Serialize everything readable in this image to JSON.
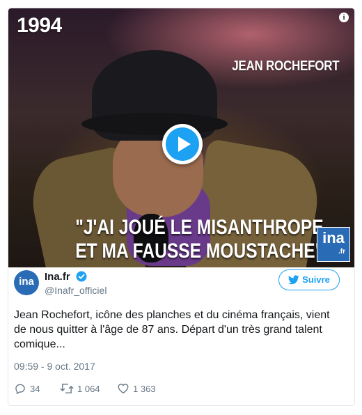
{
  "media": {
    "year": "1994",
    "name_tag": "JEAN ROCHEFORT",
    "quote_line1": "\"J'AI JOUÉ LE MISANTHROPE",
    "quote_line2": "ET MA FAUSSE MOUSTACHE\"",
    "logo_text": "ina",
    "logo_suffix": ".fr",
    "info_icon": "info-icon",
    "play_icon": "play-icon"
  },
  "author": {
    "display_name": "Ina.fr",
    "handle": "@Inafr_officiel",
    "avatar_text": "ina",
    "verified_icon": "verified-badge-icon"
  },
  "follow_button": {
    "label": "Suivre",
    "icon": "twitter-bird-icon"
  },
  "tweet": {
    "text": "Jean Rochefort, icône des planches et du cinéma français, vient de nous quitter à l'âge de 87 ans. Départ d'un très grand talent comique...",
    "timestamp": "09:59 - 9 oct. 2017"
  },
  "actions": {
    "replies": "34",
    "retweets": "1 064",
    "likes": "1 363",
    "reply_icon": "reply-icon",
    "retweet_icon": "retweet-icon",
    "like_icon": "heart-icon"
  },
  "colors": {
    "accent": "#1da1f2",
    "muted": "#657786",
    "border": "#e1e8ed",
    "ina_blue": "#2a6bb5"
  }
}
